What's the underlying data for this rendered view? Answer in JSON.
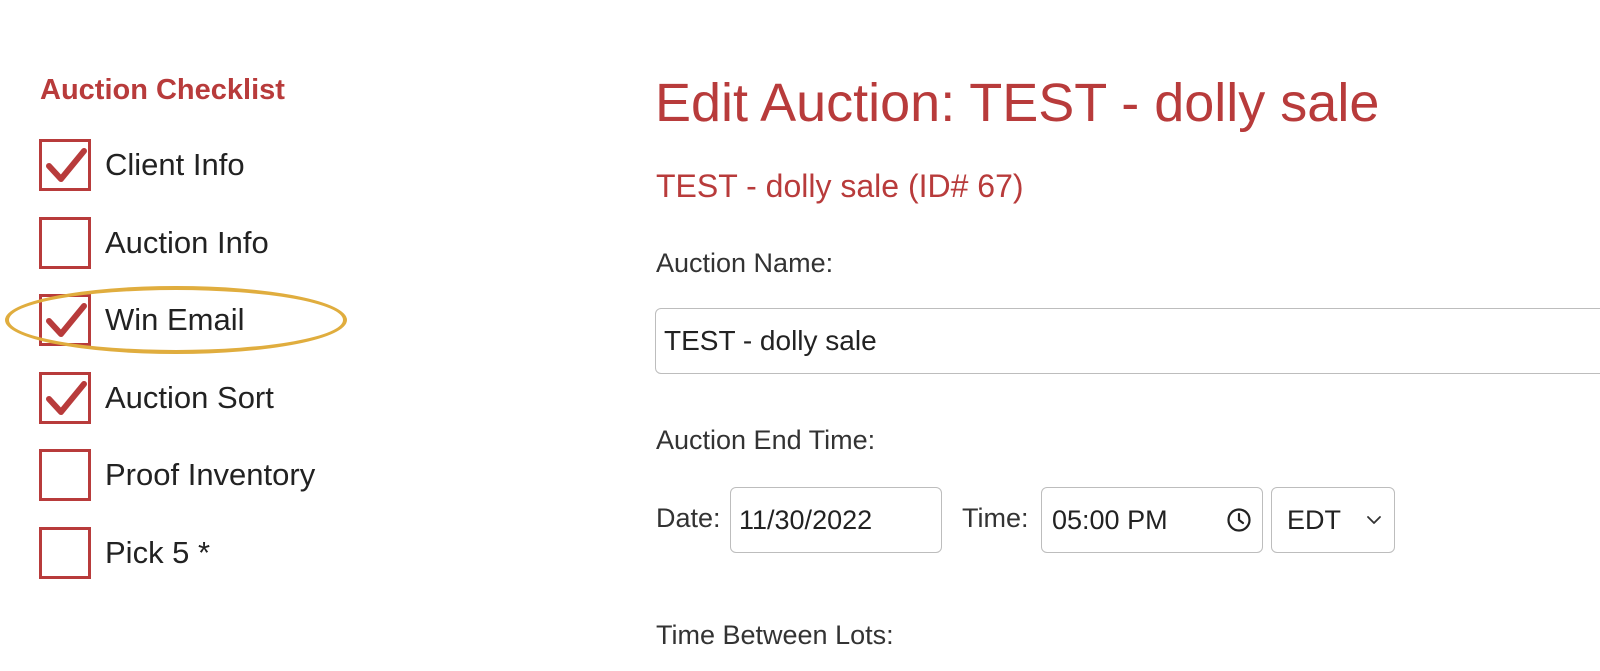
{
  "sidebar": {
    "title": "Auction Checklist",
    "items": [
      {
        "label": "Client Info",
        "checked": true
      },
      {
        "label": "Auction Info",
        "checked": false
      },
      {
        "label": "Win Email",
        "checked": true
      },
      {
        "label": "Auction Sort",
        "checked": true
      },
      {
        "label": "Proof Inventory",
        "checked": false
      },
      {
        "label": "Pick 5 *",
        "checked": false
      }
    ]
  },
  "main": {
    "title": "Edit Auction: TEST - dolly sale",
    "subtitle": "TEST - dolly sale (ID# 67)",
    "auction_name_label": "Auction Name:",
    "auction_name_value": "TEST - dolly sale",
    "end_time_label": "Auction End Time:",
    "date_label": "Date:",
    "date_value": "11/30/2022",
    "time_label": "Time:",
    "time_value": "05:00 PM",
    "timezone_value": "EDT",
    "time_between_lots_label": "Time Between Lots:"
  },
  "colors": {
    "accent": "#b83b3b",
    "highlight": "#e0ad3e"
  }
}
